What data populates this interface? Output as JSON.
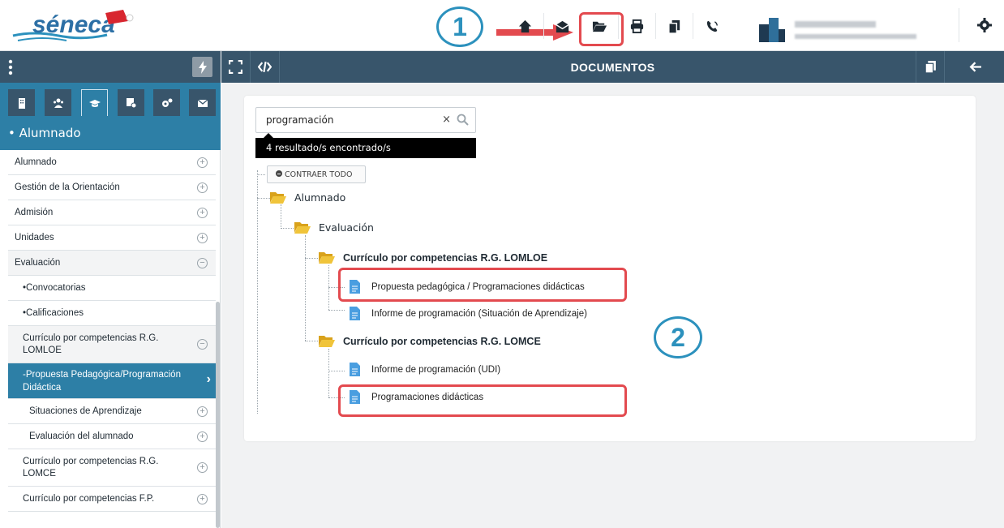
{
  "header": {
    "logo_text": "séneca",
    "top_icons": [
      "home-icon",
      "mail-icon",
      "folder-open-icon",
      "print-icon",
      "copy-icon",
      "phone-icon"
    ],
    "settings_icon": "gear-icon",
    "annotation_1": "1",
    "annotation_2": "2"
  },
  "left_header": {
    "menu_icon": "kebab-icon",
    "flash_icon": "lightning-icon"
  },
  "main_header": {
    "title": "DOCUMENTOS",
    "left_icons": [
      "expand-icon",
      "code-icon"
    ],
    "right_icons": [
      "copy-icon",
      "arrow-left-icon"
    ]
  },
  "sidebar": {
    "tabs": [
      "building-icon",
      "users-icon",
      "graduation-cap-icon",
      "certificate-icon",
      "gears-icon",
      "envelope-icon"
    ],
    "section_title": "• Alumnado",
    "items": [
      {
        "label": "Alumnado",
        "toggle": "+"
      },
      {
        "label": "Gestión de la Orientación",
        "toggle": "+"
      },
      {
        "label": "Admisión",
        "toggle": "+"
      },
      {
        "label": "Unidades",
        "toggle": "+"
      },
      {
        "label": "Evaluación",
        "toggle": "−"
      },
      {
        "label": "•Convocatorias"
      },
      {
        "label": "•Calificaciones"
      },
      {
        "label": "Currículo por competencias R.G. LOMLOE",
        "toggle": "−"
      },
      {
        "label": "-Propuesta Pedagógica/Programación Didáctica",
        "chevron": "›"
      },
      {
        "label": "Situaciones de Aprendizaje",
        "toggle": "+"
      },
      {
        "label": "Evaluación del alumnado",
        "toggle": "+"
      },
      {
        "label": "Currículo por competencias R.G. LOMCE",
        "toggle": "+"
      },
      {
        "label": "Currículo por competencias F.P.",
        "toggle": "+"
      }
    ]
  },
  "search": {
    "value": "programación",
    "clear": "×",
    "results_text": "4 resultado/s encontrado/s",
    "collapse_label": "CONTRAER TODO"
  },
  "tree": {
    "root": "Alumnado",
    "level1": "Evaluación",
    "group1": "Currículo por competencias R.G. LOMLOE",
    "group1_docs": [
      "Propuesta pedagógica / Programaciones didácticas",
      "Informe de programación (Situación de Aprendizaje)"
    ],
    "group2": "Currículo por competencias R.G. LOMCE",
    "group2_docs": [
      "Informe de programación (UDI)",
      "Programaciones didácticas"
    ]
  },
  "colors": {
    "header_bg": "#38556b",
    "accent": "#2d7fa6",
    "highlight": "#e34a4f",
    "folder": "#e8b829",
    "doc": "#4a9ee0"
  }
}
